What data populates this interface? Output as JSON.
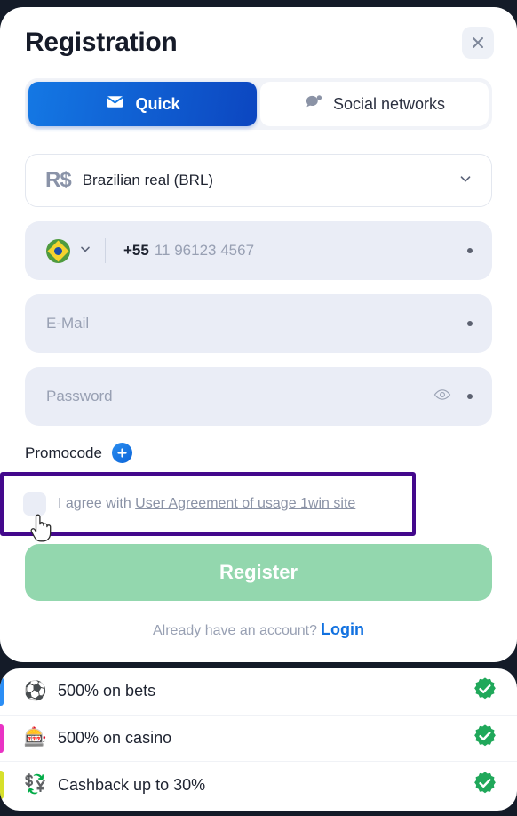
{
  "header": {
    "title": "Registration",
    "close_icon": "close-icon"
  },
  "tabs": [
    {
      "label": "Quick",
      "icon": "envelope-icon",
      "active": true
    },
    {
      "label": "Social networks",
      "icon": "chat-bubble-icon",
      "active": false
    }
  ],
  "currency": {
    "symbol": "R$",
    "name": "Brazilian real (BRL)",
    "chevron_icon": "chevron-down-icon"
  },
  "phone": {
    "flag_icon": "brazil-flag-icon",
    "chevron_icon": "chevron-down-icon",
    "dial_code": "+55",
    "placeholder": "11 96123 4567"
  },
  "email": {
    "placeholder": "E-Mail",
    "value": ""
  },
  "password": {
    "placeholder": "Password",
    "value": "",
    "eye_icon": "eye-icon"
  },
  "promocode": {
    "label": "Promocode",
    "add_icon": "plus-icon"
  },
  "agreement": {
    "checked": false,
    "prefix": "I agree with ",
    "link_text": "User Agreement of usage 1win site",
    "highlighted": true
  },
  "register_button": {
    "label": "Register",
    "disabled": true
  },
  "login_prompt": {
    "text": "Already have an account?",
    "link": "Login"
  },
  "bonuses": [
    {
      "emoji": "⚽",
      "icon": "soccer-ball-icon",
      "label": "500% on bets",
      "accent": "#2b8ef5",
      "check_icon": "verified-check-icon"
    },
    {
      "emoji": "🎰",
      "icon": "slot-machine-icon",
      "label": "500% on casino",
      "accent": "#e933c4",
      "check_icon": "verified-check-icon"
    },
    {
      "emoji": "💱",
      "icon": "cashback-icon",
      "label": "Cashback up to 30%",
      "accent": "#d7e02a",
      "check_icon": "verified-check-icon"
    }
  ],
  "colors": {
    "page_background": "#141b28",
    "tab_active_from": "#1478e4",
    "tab_active_to": "#0c46c0",
    "field_background": "#eaedf6",
    "register_green": "#93d7ae",
    "highlight_purple": "#43088c",
    "link_blue": "#1171e0",
    "badge_green": "#20a85a"
  }
}
